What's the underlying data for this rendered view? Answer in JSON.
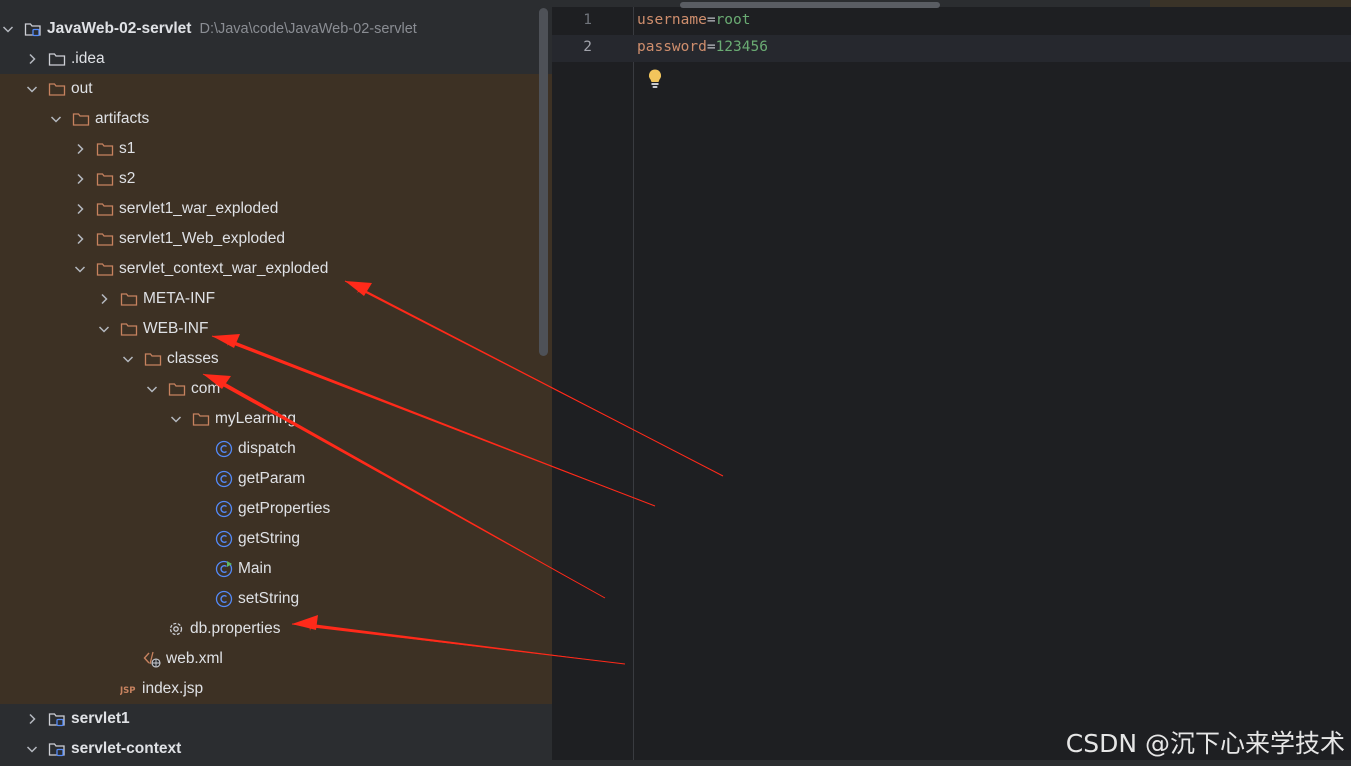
{
  "project_tree": {
    "rows": [
      {
        "label": "JavaWeb-02-servlet",
        "path": "D:\\Java\\code\\JavaWeb-02-servlet",
        "bold": true,
        "icon": "module-folder-icon",
        "chevron": "down"
      },
      {
        "label": ".idea",
        "icon": "folder-icon",
        "chevron": "right"
      },
      {
        "label": "out",
        "icon": "excluded-folder-icon",
        "chevron": "down"
      },
      {
        "label": "artifacts",
        "icon": "excluded-folder-icon",
        "chevron": "down"
      },
      {
        "label": "s1",
        "icon": "excluded-folder-icon",
        "chevron": "right"
      },
      {
        "label": "s2",
        "icon": "excluded-folder-icon",
        "chevron": "right"
      },
      {
        "label": "servlet1_war_exploded",
        "icon": "excluded-folder-icon",
        "chevron": "right"
      },
      {
        "label": "servlet1_Web_exploded",
        "icon": "excluded-folder-icon",
        "chevron": "right"
      },
      {
        "label": "servlet_context_war_exploded",
        "icon": "excluded-folder-icon",
        "chevron": "down"
      },
      {
        "label": "META-INF",
        "icon": "excluded-folder-icon",
        "chevron": "right"
      },
      {
        "label": "WEB-INF",
        "icon": "excluded-folder-icon",
        "chevron": "down"
      },
      {
        "label": "classes",
        "icon": "excluded-folder-icon",
        "chevron": "down"
      },
      {
        "label": "com",
        "icon": "excluded-folder-icon",
        "chevron": "down"
      },
      {
        "label": "myLearning",
        "icon": "excluded-folder-icon",
        "chevron": "down"
      },
      {
        "label": "dispatch",
        "icon": "class-icon",
        "chevron": ""
      },
      {
        "label": "getParam",
        "icon": "class-icon",
        "chevron": ""
      },
      {
        "label": "getProperties",
        "icon": "class-icon",
        "chevron": ""
      },
      {
        "label": "getString",
        "icon": "class-icon",
        "chevron": ""
      },
      {
        "label": "Main",
        "icon": "runnable-class-icon",
        "chevron": ""
      },
      {
        "label": "setString",
        "icon": "class-icon",
        "chevron": ""
      },
      {
        "label": "db.properties",
        "icon": "properties-file-icon",
        "chevron": ""
      },
      {
        "label": "web.xml",
        "icon": "xml-file-icon",
        "chevron": ""
      },
      {
        "label": "index.jsp",
        "icon": "jsp-file-icon",
        "chevron": ""
      },
      {
        "label": "servlet1",
        "bold": true,
        "icon": "module-folder-icon",
        "chevron": "right"
      },
      {
        "label": "servlet-context",
        "bold": true,
        "icon": "module-folder-icon",
        "chevron": "down"
      }
    ]
  },
  "editor": {
    "lines": [
      {
        "number": "1",
        "key": "username",
        "eq": "=",
        "value": "root"
      },
      {
        "number": "2",
        "key": "password",
        "eq": "=",
        "value": "123456"
      }
    ],
    "hint_icon": "lightbulb-icon"
  },
  "colors": {
    "tree_bg": "#2b2d30",
    "excluded_bg": "#3d3124",
    "editor_bg": "#1e1f22",
    "folder_orange": "#c7825f",
    "class_blue": "#548af7",
    "arrow_red": "#ff2a1a"
  },
  "watermark": "CSDN @沉下心来学技术"
}
